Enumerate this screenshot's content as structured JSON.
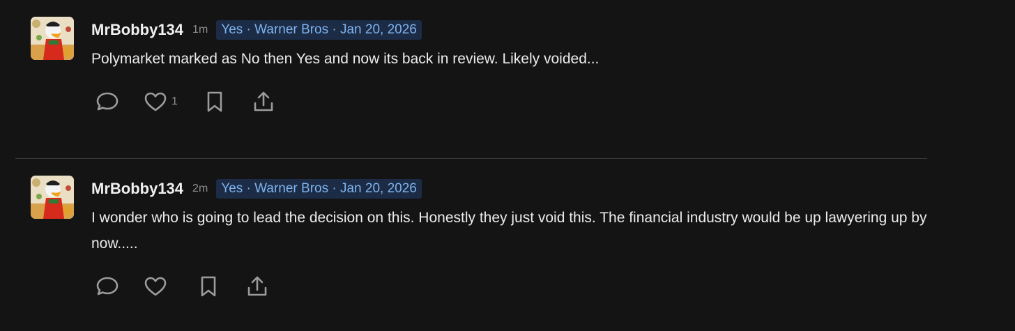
{
  "comments": [
    {
      "username": "MrBobby134",
      "time": "1m",
      "badge": "Yes · Warner Bros · Jan 20, 2026",
      "text": "Polymarket marked as No then Yes and now its back in review. Likely voided...",
      "actions": {
        "reply_icon": "speech-bubble-icon",
        "like_icon": "heart-icon",
        "like_count": "1",
        "bookmark_icon": "bookmark-icon",
        "share_icon": "share-icon"
      }
    },
    {
      "username": "MrBobby134",
      "time": "2m",
      "badge": "Yes · Warner Bros · Jan 20, 2026",
      "text": "I wonder who is going to lead the decision on this. Honestly they just void this. The financial industry would be up lawyering up by now.....",
      "actions": {
        "reply_icon": "speech-bubble-icon",
        "like_icon": "heart-icon",
        "like_count": "",
        "bookmark_icon": "bookmark-icon",
        "share_icon": "share-icon"
      }
    }
  ],
  "colors": {
    "background": "#141414",
    "badge_bg": "#1c2c46",
    "badge_text": "#7fb2ee",
    "icon": "#9c9c9c"
  }
}
